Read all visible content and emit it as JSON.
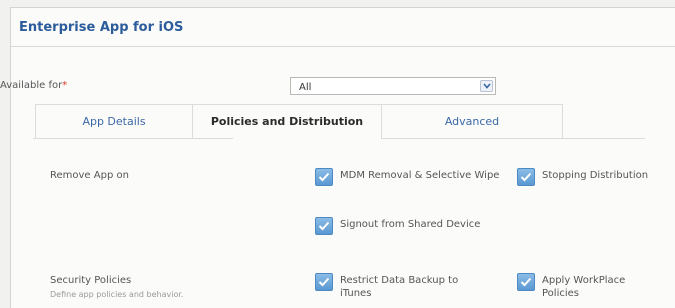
{
  "header": {
    "title": "Enterprise App for iOS"
  },
  "availability": {
    "label": "Available for",
    "required_marker": "*",
    "selected": "All"
  },
  "tabs": [
    {
      "label": "App Details",
      "active": false
    },
    {
      "label": "Policies and Distribution",
      "active": true
    },
    {
      "label": "Advanced",
      "active": false
    }
  ],
  "remove_app": {
    "label": "Remove App on",
    "options": [
      {
        "label": "MDM Removal & Selective Wipe",
        "checked": true
      },
      {
        "label": "Stopping Distribution",
        "checked": true
      },
      {
        "label": "Signout from Shared Device",
        "checked": true
      }
    ]
  },
  "security_policies": {
    "label": "Security Policies",
    "sublabel": "Define app policies and behavior.",
    "options": [
      {
        "label": "Restrict Data Backup to iTunes",
        "checked": true
      },
      {
        "label": "Apply WorkPlace Policies",
        "checked": true
      }
    ]
  },
  "colors": {
    "title": "#2c5c9b",
    "tab_link": "#3b69a6",
    "checkbox": "#5a98d2",
    "required": "#d43a2a"
  }
}
